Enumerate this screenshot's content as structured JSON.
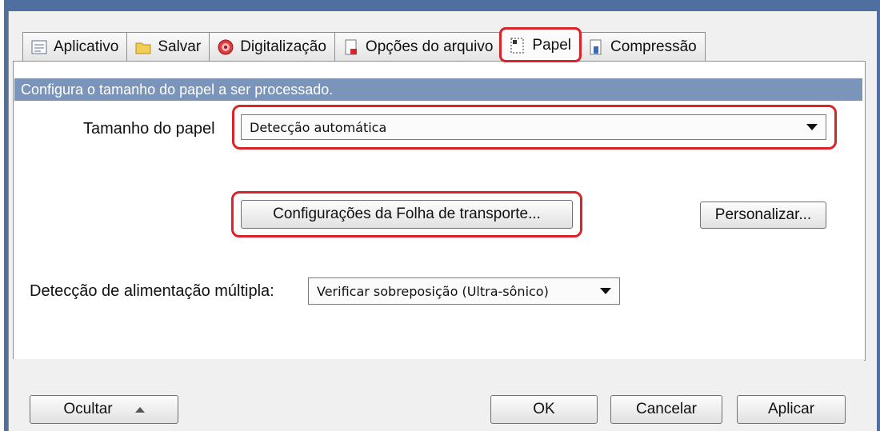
{
  "tabs": [
    {
      "label": "Aplicativo",
      "icon": "application-icon"
    },
    {
      "label": "Salvar",
      "icon": "folder-icon"
    },
    {
      "label": "Digitalização",
      "icon": "scan-icon"
    },
    {
      "label": "Opções do arquivo",
      "icon": "file-options-icon"
    },
    {
      "label": "Papel",
      "icon": "paper-icon",
      "active": true
    },
    {
      "label": "Compressão",
      "icon": "compression-icon"
    }
  ],
  "banner": "Configura o tamanho do papel a ser processado.",
  "paper_size": {
    "label": "Tamanho do papel",
    "value": "Detecção automática"
  },
  "carrier_sheet_button": "Configurações da Folha de transporte...",
  "customize_button": "Personalizar...",
  "multifeed": {
    "label": "Detecção de alimentação múltipla:",
    "value": "Verificar sobreposição (Ultra-sônico)"
  },
  "footer": {
    "hide": "Ocultar",
    "ok": "OK",
    "cancel": "Cancelar",
    "apply": "Aplicar"
  },
  "colors": {
    "highlight": "#d8242b",
    "banner": "#7a94ba",
    "title_bar": "#4f6fa0"
  }
}
